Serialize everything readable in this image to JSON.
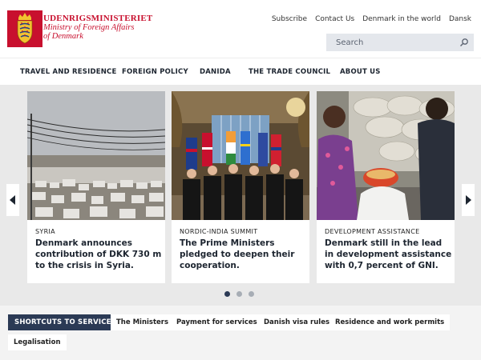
{
  "header": {
    "logo_line1": "UDENRIGSMINISTERIET",
    "logo_line2": "Ministry of Foreign Affairs",
    "logo_line3": "of Denmark",
    "top_links": [
      "Subscribe",
      "Contact Us",
      "Denmark in the world",
      "Dansk"
    ],
    "search_placeholder": "Search"
  },
  "nav": {
    "items": [
      "TRAVEL AND RESIDENCE",
      "FOREIGN POLICY",
      "DANIDA",
      "THE TRADE COUNCIL",
      "ABOUT US"
    ]
  },
  "carousel": {
    "cards": [
      {
        "category": "SYRIA",
        "headline": "Denmark announces contribution of DKK 730 m to the crisis in Syria."
      },
      {
        "category": "NORDIC-INDIA SUMMIT",
        "headline": "The Prime Ministers pledged to deepen their cooperation."
      },
      {
        "category": "DEVELOPMENT ASSISTANCE",
        "headline": "Denmark still in the lead in development assistance with 0,7 percent of GNI."
      }
    ],
    "active_slide": 1,
    "slide_count": 3
  },
  "shortcuts": {
    "title": "SHORTCUTS TO SERVICES",
    "buttons": [
      "The Ministers",
      "Payment for services",
      "Danish visa rules",
      "Residence and work permits",
      "Legalisation"
    ]
  },
  "colors": {
    "brand_red": "#c8102e",
    "navy": "#2b3a55",
    "search_bg": "#e4e7ec"
  },
  "icons": [
    "royal-crest-icon",
    "search-icon",
    "chevron-left-icon",
    "chevron-right-icon"
  ]
}
